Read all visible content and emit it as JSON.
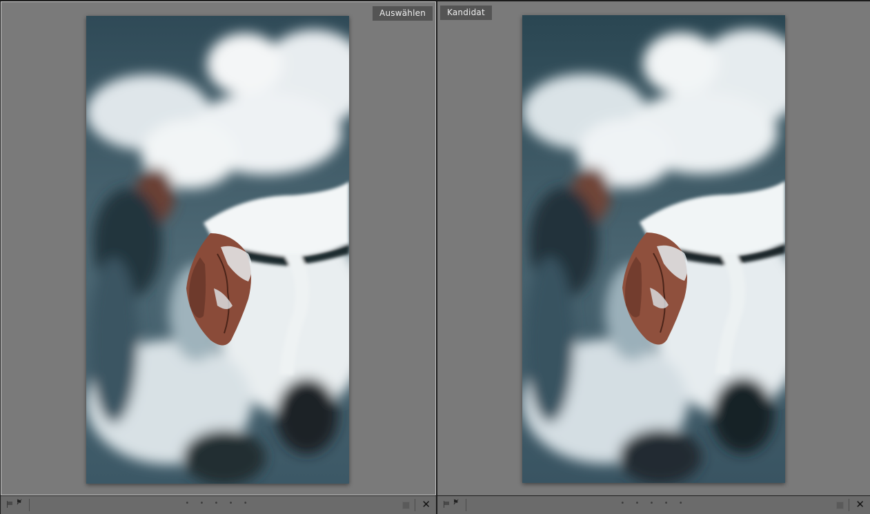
{
  "panes": {
    "left": {
      "label": "Auswählen"
    },
    "right": {
      "label": "Kandidat"
    }
  },
  "toolbar": {
    "flag_icon": "flag-icon",
    "reject_icon": "reject-flag-icon",
    "rating_dots": "• • • • •",
    "close_symbol": "✕"
  },
  "colors": {
    "background": "#7a7a7a",
    "label_bg": "#545454",
    "selected_border": "#c9c9c9"
  }
}
